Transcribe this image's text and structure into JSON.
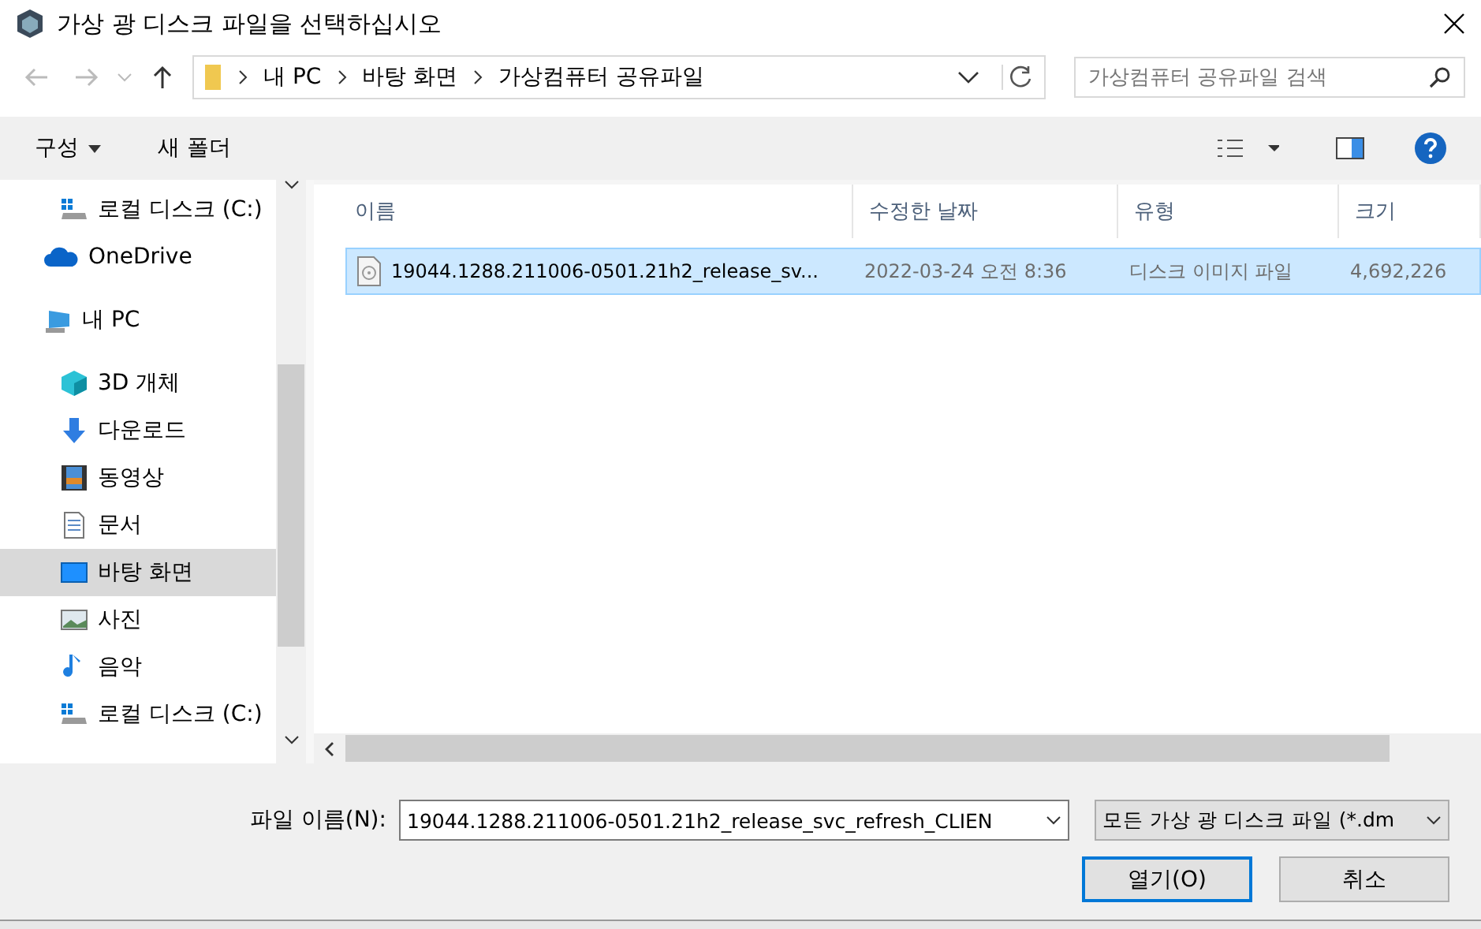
{
  "window": {
    "title": "가상 광 디스크 파일을 선택하십시오"
  },
  "address_bar": {
    "path": [
      "내 PC",
      "바탕 화면",
      "가상컴퓨터 공유파일"
    ]
  },
  "search": {
    "placeholder": "가상컴퓨터 공유파일 검색"
  },
  "toolbar": {
    "organize": "구성",
    "new_folder": "새 폴더"
  },
  "sidebar": {
    "items": [
      {
        "children": [
          {
            "label": "로컬 디스크 (C:)",
            "kind": "drive",
            "selected": false
          }
        ]
      },
      {
        "label": "OneDrive",
        "kind": "cloud",
        "selected": false
      },
      {
        "label": "내 PC",
        "kind": "pc",
        "selected": false,
        "children": [
          {
            "label": "3D 개체",
            "kind": "cube",
            "selected": false
          },
          {
            "label": "다운로드",
            "kind": "download",
            "selected": false
          },
          {
            "label": "동영상",
            "kind": "video",
            "selected": false
          },
          {
            "label": "문서",
            "kind": "document",
            "selected": false
          },
          {
            "label": "바탕 화면",
            "kind": "desktop",
            "selected": true
          },
          {
            "label": "사진",
            "kind": "picture",
            "selected": false
          },
          {
            "label": "음악",
            "kind": "music",
            "selected": false
          },
          {
            "label": "로컬 디스크 (C:)",
            "kind": "drive",
            "selected": false
          }
        ]
      }
    ]
  },
  "table": {
    "columns": [
      "이름",
      "수정한 날짜",
      "유형",
      "크기"
    ],
    "rows": [
      {
        "name": "19044.1288.211006-0501.21h2_release_sv...",
        "modified": "2022-03-24 오전 8:36",
        "type": "디스크 이미지 파일",
        "size": "4,692,226",
        "selected": true
      }
    ]
  },
  "footer": {
    "file_name_label": "파일 이름(N):",
    "file_name_value": "19044.1288.211006-0501.21h2_release_svc_refresh_CLIEN",
    "filter": "모든 가상 광 디스크 파일 (*.dm",
    "open": "열기(O)",
    "cancel": "취소"
  }
}
